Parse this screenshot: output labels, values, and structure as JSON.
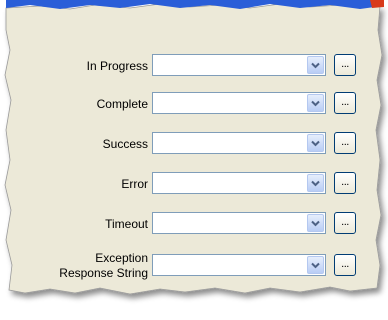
{
  "form": {
    "fields": [
      {
        "key": "in_progress",
        "label": "In Progress",
        "value": "",
        "browse_label": "..."
      },
      {
        "key": "complete",
        "label": "Complete",
        "value": "",
        "browse_label": "..."
      },
      {
        "key": "success",
        "label": "Success",
        "value": "",
        "browse_label": "..."
      },
      {
        "key": "error",
        "label": "Error",
        "value": "",
        "browse_label": "..."
      },
      {
        "key": "timeout",
        "label": "Timeout",
        "value": "",
        "browse_label": "..."
      },
      {
        "key": "exception_response_string",
        "label": "Exception\nResponse String",
        "value": "",
        "browse_label": "..."
      }
    ]
  },
  "colors": {
    "panel_background": "#ece9d8",
    "title_bar": "#2a5ed8",
    "combo_border": "#7f9db9",
    "button_border": "#003c74",
    "accent_red": "#d83a1a"
  },
  "icons": {
    "dropdown": "chevron-down-icon"
  }
}
